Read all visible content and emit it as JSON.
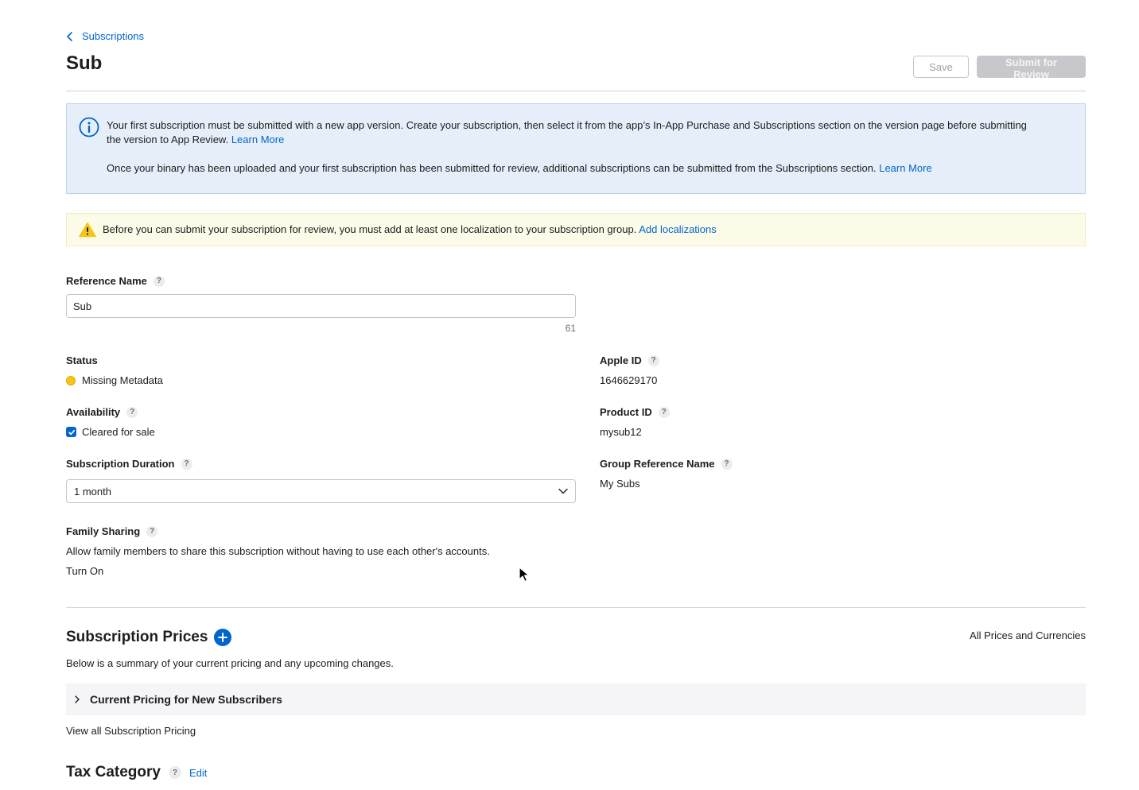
{
  "breadcrumb": {
    "label": "Subscriptions"
  },
  "page": {
    "title": "Sub"
  },
  "actions": {
    "save_label": "Save",
    "submit_label": "Submit for Review"
  },
  "info_banner": {
    "text1": "Your first subscription must be submitted with a new app version. Create your subscription, then select it from the app’s In-App Purchase and Subscriptions section on the version page before submitting the version to App Review.",
    "link1": "Learn More",
    "text2": "Once your binary has been uploaded and your first subscription has been submitted for review, additional subscriptions can be submitted from the Subscriptions section.",
    "link2": "Learn More"
  },
  "warning_banner": {
    "text": "Before you can submit your subscription for review, you must add at least one localization to your subscription group.",
    "link": "Add localizations"
  },
  "reference_name": {
    "label": "Reference Name",
    "value": "Sub",
    "remaining": "61"
  },
  "status": {
    "label": "Status",
    "value": "Missing Metadata",
    "color": "#f5c518"
  },
  "availability": {
    "label": "Availability",
    "checkbox_label": "Cleared for sale",
    "checked": true
  },
  "duration": {
    "label": "Subscription Duration",
    "selected": "1 month"
  },
  "family_sharing": {
    "label": "Family Sharing",
    "description": "Allow family members to share this subscription without having to use each other's accounts.",
    "action": "Turn On"
  },
  "apple_id": {
    "label": "Apple ID",
    "value": "1646629170"
  },
  "product_id": {
    "label": "Product ID",
    "value": "mysub12"
  },
  "group_reference": {
    "label": "Group Reference Name",
    "value": "My Subs"
  },
  "prices": {
    "title": "Subscription Prices",
    "all_link": "All Prices and Currencies",
    "description": "Below is a summary of your current pricing and any upcoming changes.",
    "row_label": "Current Pricing for New Subscribers",
    "view_all": "View all Subscription Pricing"
  },
  "tax": {
    "title": "Tax Category",
    "edit": "Edit"
  },
  "help_glyph": "?",
  "colors": {
    "accent": "#0066cc",
    "info_bg": "#e6eff9",
    "warning_bg": "#fcfbe8",
    "warning_icon": "#f5c518"
  }
}
